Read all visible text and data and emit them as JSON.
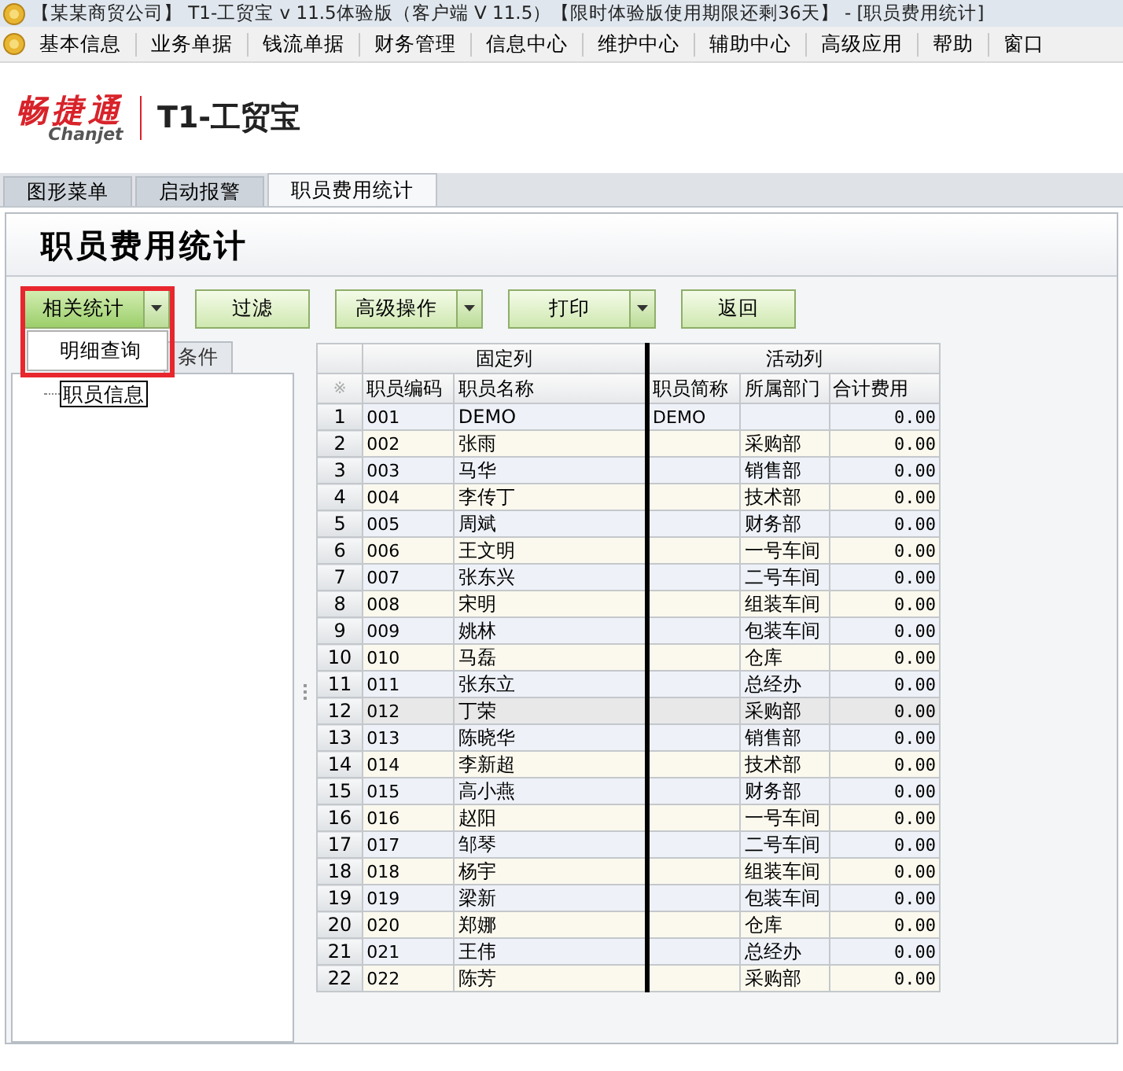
{
  "window": {
    "title": "【某某商贸公司】 T1-工贸宝 v 11.5体验版（客户端 V 11.5）【限时体验版使用期限还剩36天】 - [职员费用统计]"
  },
  "menu": [
    "基本信息",
    "业务单据",
    "钱流单据",
    "财务管理",
    "信息中心",
    "维护中心",
    "辅助中心",
    "高级应用",
    "帮助",
    "窗口"
  ],
  "logo": {
    "brand": "畅捷通",
    "brand_latin": "Chanjet",
    "product": "T1-工贸宝"
  },
  "tabs": [
    {
      "label": "图形菜单",
      "selected": false
    },
    {
      "label": "启动报警",
      "selected": false
    },
    {
      "label": "职员费用统计",
      "selected": true
    }
  ],
  "page_title": "职员费用统计",
  "toolbar": [
    {
      "label": "相关统计",
      "kind": "split"
    },
    {
      "label": "过滤",
      "kind": "plain"
    },
    {
      "label": "高级操作",
      "kind": "split"
    },
    {
      "label": "打印",
      "kind": "split"
    },
    {
      "label": "返回",
      "kind": "plain"
    }
  ],
  "dropdown_menu": {
    "items": [
      "明细查询"
    ]
  },
  "left_panel": {
    "tab": "条件",
    "tree": [
      {
        "label": "职员信息",
        "selected": true
      }
    ]
  },
  "grid": {
    "corner": "※",
    "groups": [
      {
        "label": "固定列"
      },
      {
        "label": "活动列"
      }
    ],
    "columns": [
      "职员编码",
      "职员名称",
      "职员简称",
      "所属部门",
      "合计费用"
    ],
    "rows": [
      {
        "no": "1",
        "code": "001",
        "name": "DEMO",
        "short": "DEMO",
        "dept": "",
        "total": "0.00",
        "selected": false
      },
      {
        "no": "2",
        "code": "002",
        "name": "张雨",
        "short": "",
        "dept": "采购部",
        "total": "0.00",
        "selected": false
      },
      {
        "no": "3",
        "code": "003",
        "name": "马华",
        "short": "",
        "dept": "销售部",
        "total": "0.00",
        "selected": false
      },
      {
        "no": "4",
        "code": "004",
        "name": "李传丁",
        "short": "",
        "dept": "技术部",
        "total": "0.00",
        "selected": false
      },
      {
        "no": "5",
        "code": "005",
        "name": "周斌",
        "short": "",
        "dept": "财务部",
        "total": "0.00",
        "selected": false
      },
      {
        "no": "6",
        "code": "006",
        "name": "王文明",
        "short": "",
        "dept": "一号车间",
        "total": "0.00",
        "selected": false
      },
      {
        "no": "7",
        "code": "007",
        "name": "张东兴",
        "short": "",
        "dept": "二号车间",
        "total": "0.00",
        "selected": false
      },
      {
        "no": "8",
        "code": "008",
        "name": "宋明",
        "short": "",
        "dept": "组装车间",
        "total": "0.00",
        "selected": false
      },
      {
        "no": "9",
        "code": "009",
        "name": "姚林",
        "short": "",
        "dept": "包装车间",
        "total": "0.00",
        "selected": false
      },
      {
        "no": "10",
        "code": "010",
        "name": "马磊",
        "short": "",
        "dept": "仓库",
        "total": "0.00",
        "selected": false
      },
      {
        "no": "11",
        "code": "011",
        "name": "张东立",
        "short": "",
        "dept": "总经办",
        "total": "0.00",
        "selected": false
      },
      {
        "no": "12",
        "code": "012",
        "name": "丁荣",
        "short": "",
        "dept": "采购部",
        "total": "0.00",
        "selected": true
      },
      {
        "no": "13",
        "code": "013",
        "name": "陈晓华",
        "short": "",
        "dept": "销售部",
        "total": "0.00",
        "selected": false
      },
      {
        "no": "14",
        "code": "014",
        "name": "李新超",
        "short": "",
        "dept": "技术部",
        "total": "0.00",
        "selected": false
      },
      {
        "no": "15",
        "code": "015",
        "name": "高小燕",
        "short": "",
        "dept": "财务部",
        "total": "0.00",
        "selected": false
      },
      {
        "no": "16",
        "code": "016",
        "name": "赵阳",
        "short": "",
        "dept": "一号车间",
        "total": "0.00",
        "selected": false
      },
      {
        "no": "17",
        "code": "017",
        "name": "邹琴",
        "short": "",
        "dept": "二号车间",
        "total": "0.00",
        "selected": false
      },
      {
        "no": "18",
        "code": "018",
        "name": "杨宇",
        "short": "",
        "dept": "组装车间",
        "total": "0.00",
        "selected": false
      },
      {
        "no": "19",
        "code": "019",
        "name": "梁新",
        "short": "",
        "dept": "包装车间",
        "total": "0.00",
        "selected": false
      },
      {
        "no": "20",
        "code": "020",
        "name": "郑娜",
        "short": "",
        "dept": "仓库",
        "total": "0.00",
        "selected": false
      },
      {
        "no": "21",
        "code": "021",
        "name": "王伟",
        "short": "",
        "dept": "总经办",
        "total": "0.00",
        "selected": false
      },
      {
        "no": "22",
        "code": "022",
        "name": "陈芳",
        "short": "",
        "dept": "采购部",
        "total": "0.00",
        "selected": false
      }
    ]
  }
}
